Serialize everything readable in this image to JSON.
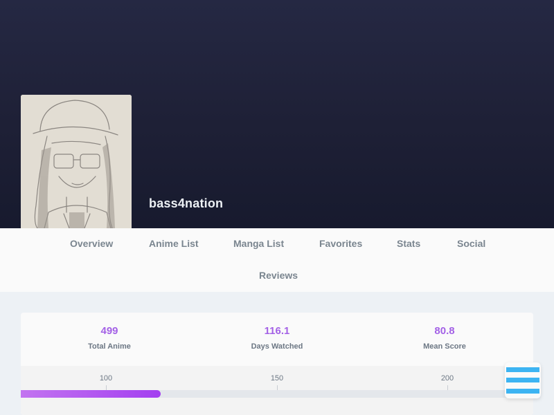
{
  "profile": {
    "username": "bass4nation"
  },
  "nav": {
    "items": [
      {
        "label": "Overview"
      },
      {
        "label": "Anime List"
      },
      {
        "label": "Manga List"
      },
      {
        "label": "Favorites"
      },
      {
        "label": "Stats"
      },
      {
        "label": "Social"
      },
      {
        "label": "Reviews"
      }
    ]
  },
  "stats": {
    "total_anime": {
      "value": "499",
      "label": "Total Anime"
    },
    "days_watched": {
      "value": "116.1",
      "label": "Days Watched"
    },
    "mean_score": {
      "value": "80.8",
      "label": "Mean Score"
    }
  },
  "progress": {
    "milestones": [
      "100",
      "150",
      "200"
    ],
    "fill_percent": 27.3
  },
  "colors": {
    "accent_purple": "#a361e6",
    "menu_blue": "#3db4f2",
    "banner_dark": "#1e2036"
  },
  "icons": {
    "menu": "hamburger-menu-icon"
  }
}
